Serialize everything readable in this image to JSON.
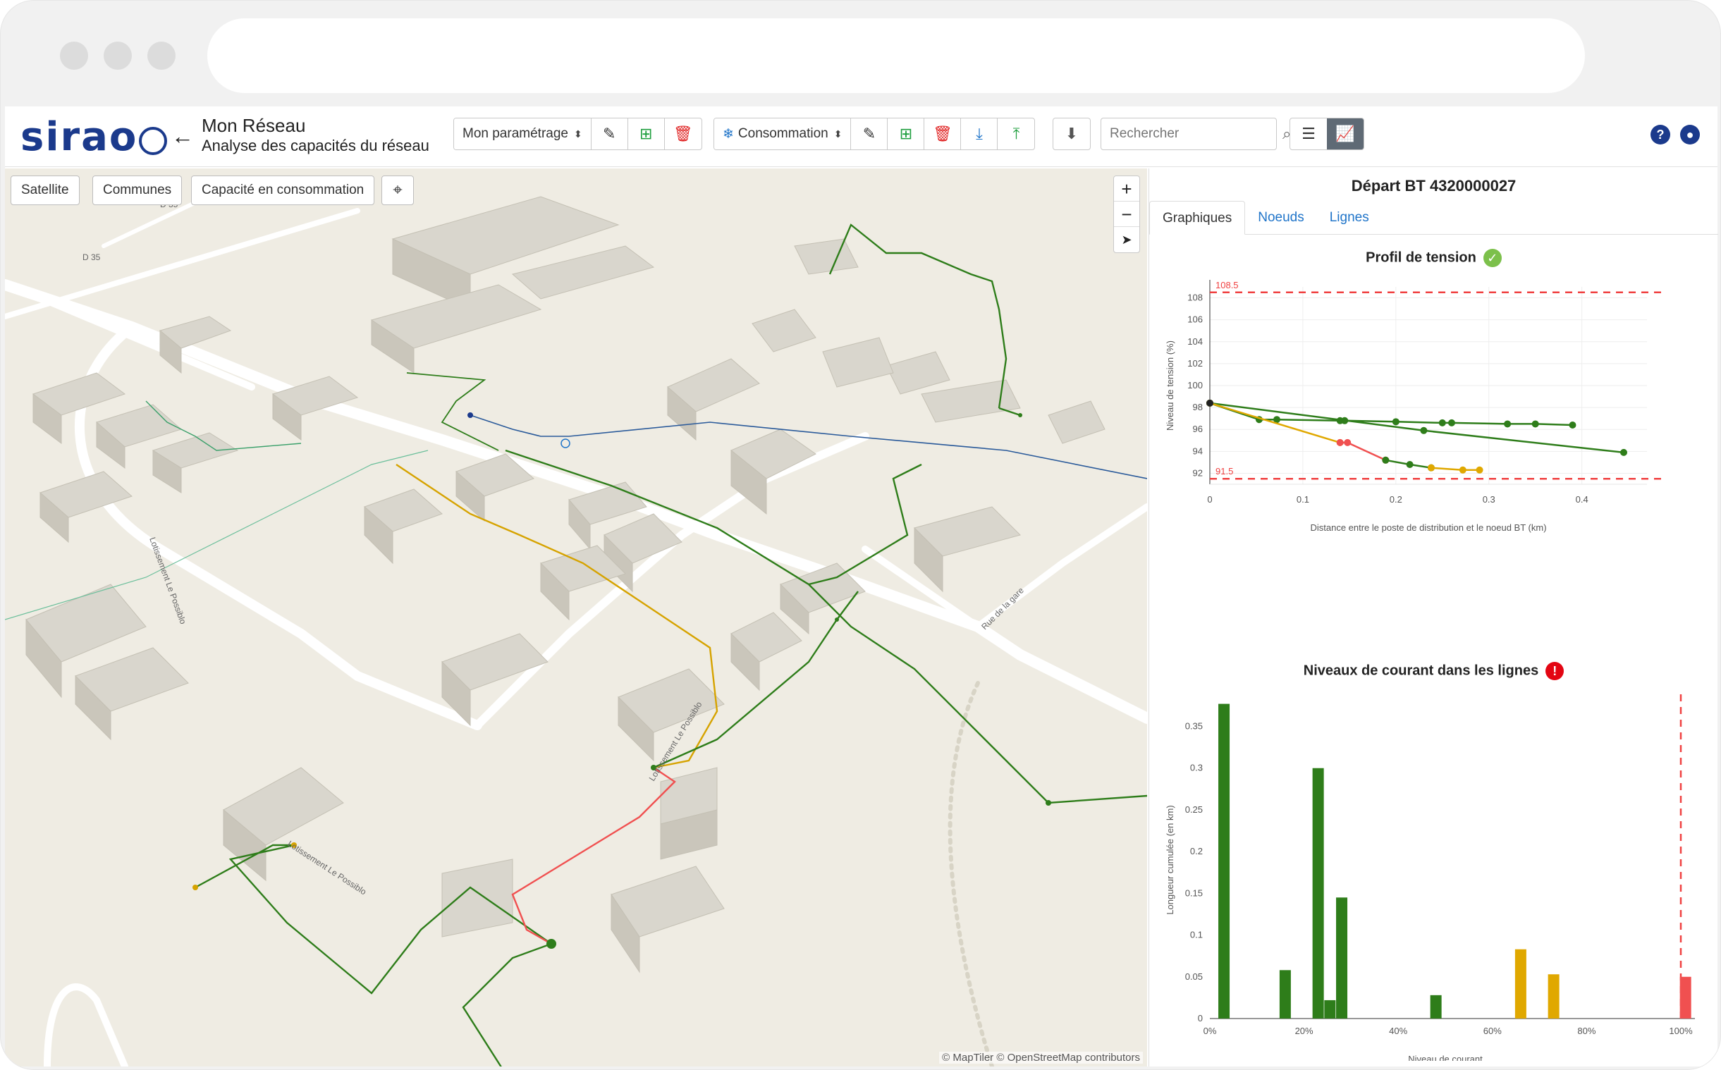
{
  "header": {
    "logo": "sirao",
    "title": "Mon Réseau",
    "subtitle": "Analyse des capacités du réseau",
    "param_select": "Mon paramétrage",
    "conso_select": "Consommation",
    "search_placeholder": "Rechercher"
  },
  "map": {
    "btn_satellite": "Satellite",
    "btn_communes": "Communes",
    "btn_capacite": "Capacité en consommation",
    "zoom_in": "+",
    "zoom_out": "−",
    "attribution": "© MapTiler © OpenStreetMap contributors",
    "road_labels": [
      "Lotissement Le Possiblo",
      "Lotissement Le Possiblo",
      "Lotissement Le Possiblo",
      "Rue de la gare",
      "D 35",
      "D 35"
    ]
  },
  "panel": {
    "title": "Départ BT 4320000027",
    "tabs": [
      "Graphiques",
      "Noeuds",
      "Lignes"
    ],
    "chart1_title": "Profil de tension",
    "chart2_title": "Niveaux de courant dans les lignes"
  },
  "colors": {
    "green": "#2e7d1a",
    "orange": "#e0a800",
    "red": "#f05050",
    "limit": "#f04040"
  },
  "chart_data": [
    {
      "type": "line",
      "title": "Profil de tension",
      "xlabel": "Distance entre le poste de distribution et le noeud BT (km)",
      "ylabel": "Niveau de tension (%)",
      "xlim": [
        0,
        0.47
      ],
      "ylim": [
        91,
        109
      ],
      "xticks": [
        0,
        0.1,
        0.2,
        0.3,
        0.4
      ],
      "yticks": [
        92,
        94,
        96,
        98,
        100,
        102,
        104,
        106,
        108
      ],
      "limits": [
        {
          "label": "108.5",
          "value": 108.5
        },
        {
          "label": "91.5",
          "value": 91.5
        }
      ],
      "series": [
        {
          "color": "green",
          "points": [
            [
              0,
              98.4
            ],
            [
              0.053,
              96.9
            ],
            [
              0.072,
              96.9
            ],
            [
              0.14,
              96.8
            ],
            [
              0.145,
              96.8
            ],
            [
              0.2,
              96.7
            ],
            [
              0.25,
              96.6
            ],
            [
              0.26,
              96.6
            ],
            [
              0.32,
              96.5
            ],
            [
              0.35,
              96.5
            ],
            [
              0.39,
              96.4
            ]
          ]
        },
        {
          "color": "green",
          "points": [
            [
              0,
              98.4
            ],
            [
              0.23,
              95.9
            ],
            [
              0.445,
              93.9
            ]
          ]
        },
        {
          "color": "orange",
          "points": [
            [
              0,
              98.4
            ],
            [
              0.14,
              94.8
            ]
          ]
        },
        {
          "color": "red",
          "points": [
            [
              0.14,
              94.8
            ],
            [
              0.148,
              94.8
            ],
            [
              0.189,
              93.2
            ]
          ]
        },
        {
          "color": "green",
          "points": [
            [
              0.189,
              93.2
            ],
            [
              0.215,
              92.8
            ],
            [
              0.238,
              92.5
            ]
          ]
        },
        {
          "color": "orange",
          "points": [
            [
              0.238,
              92.5
            ],
            [
              0.272,
              92.3
            ],
            [
              0.29,
              92.3
            ]
          ]
        }
      ]
    },
    {
      "type": "bar",
      "title": "Niveaux de courant dans les lignes",
      "xlabel": "Niveau de courant",
      "ylabel": "Longueur cumulée (en km)",
      "xlim": [
        0,
        100
      ],
      "ylim": [
        0,
        0.38
      ],
      "xticks": [
        "0%",
        "20%",
        "40%",
        "60%",
        "80%",
        "100%"
      ],
      "yticks": [
        0,
        0.05,
        0.1,
        0.15,
        0.2,
        0.25,
        0.3,
        0.35
      ],
      "limit_x": 100,
      "bars": [
        {
          "x": 3,
          "value": 0.377,
          "color": "green"
        },
        {
          "x": 16,
          "value": 0.058,
          "color": "green"
        },
        {
          "x": 23,
          "value": 0.3,
          "color": "green"
        },
        {
          "x": 25.5,
          "value": 0.022,
          "color": "green"
        },
        {
          "x": 28,
          "value": 0.145,
          "color": "green"
        },
        {
          "x": 48,
          "value": 0.028,
          "color": "green"
        },
        {
          "x": 66,
          "value": 0.083,
          "color": "orange"
        },
        {
          "x": 73,
          "value": 0.053,
          "color": "orange"
        },
        {
          "x": 101,
          "value": 0.05,
          "color": "red"
        }
      ]
    }
  ]
}
